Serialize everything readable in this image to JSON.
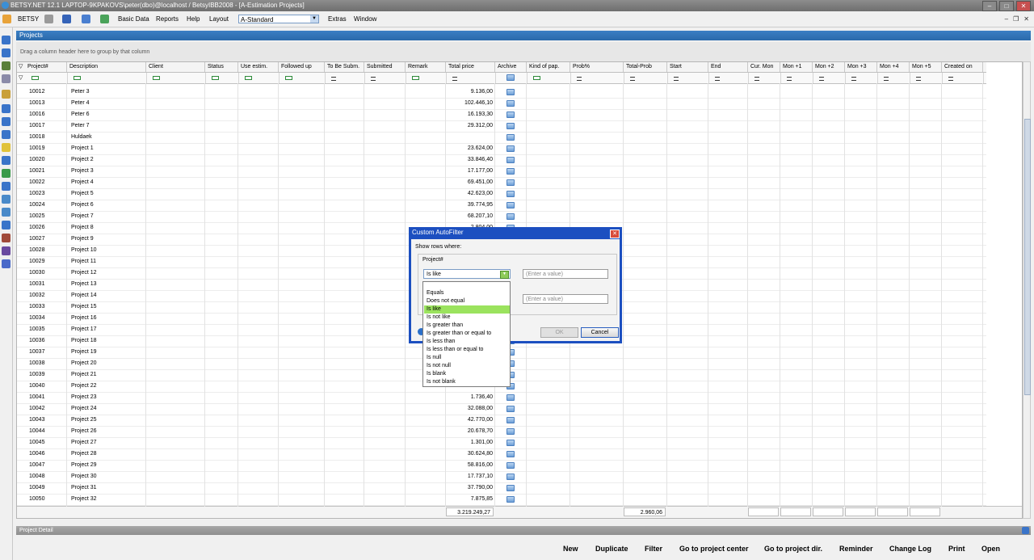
{
  "window": {
    "title": "BETSY.NET 12.1  LAPTOP-9KPAKOVS\\peter(dbo)@localhost / BetsyIBB2008 - [A-Estimation Projects]"
  },
  "menu": {
    "app_label": "BETSY",
    "items": [
      "Basic Data",
      "Reports",
      "Help",
      "Layout"
    ],
    "layout_value": "A-Standard",
    "extras": "Extras",
    "window_label": "Window"
  },
  "panel": {
    "title": "Projects",
    "group_hint": "Drag a column header here to group by that column"
  },
  "columns": [
    "Project#",
    "Description",
    "Client",
    "Status",
    "Use estim.",
    "Followed up",
    "To Be Subm.",
    "Submitted",
    "Remark",
    "Total price",
    "Archive",
    "Kind of pap.",
    "Prob%",
    "Total-Prob",
    "Start",
    "End",
    "Cur. Mon",
    "Mon +1",
    "Mon +2",
    "Mon +3",
    "Mon +4",
    "Mon +5",
    "Created on"
  ],
  "rows": [
    {
      "id": "10012",
      "desc": "Peter 3",
      "price": "9.136,00"
    },
    {
      "id": "10013",
      "desc": "Peter 4",
      "price": "102.446,10"
    },
    {
      "id": "10016",
      "desc": "Peter 6",
      "price": "16.193,30"
    },
    {
      "id": "10017",
      "desc": "Peter 7",
      "price": "29.312,00"
    },
    {
      "id": "10018",
      "desc": "Huldaek",
      "price": ""
    },
    {
      "id": "10019",
      "desc": "Project 1",
      "price": "23.624,00"
    },
    {
      "id": "10020",
      "desc": "Project 2",
      "price": "33.846,40"
    },
    {
      "id": "10021",
      "desc": "Project 3",
      "price": "17.177,00"
    },
    {
      "id": "10022",
      "desc": "Project 4",
      "price": "69.451,00"
    },
    {
      "id": "10023",
      "desc": "Project 5",
      "price": "42.623,00"
    },
    {
      "id": "10024",
      "desc": "Project 6",
      "price": "39.774,95"
    },
    {
      "id": "10025",
      "desc": "Project 7",
      "price": "68.207,10"
    },
    {
      "id": "10026",
      "desc": "Project 8",
      "price": "2.804,00"
    },
    {
      "id": "10027",
      "desc": "Project 9",
      "price": ""
    },
    {
      "id": "10028",
      "desc": "Project 10",
      "price": ""
    },
    {
      "id": "10029",
      "desc": "Project 11",
      "price": ""
    },
    {
      "id": "10030",
      "desc": "Project 12",
      "price": ""
    },
    {
      "id": "10031",
      "desc": "Project 13",
      "price": ""
    },
    {
      "id": "10032",
      "desc": "Project 14",
      "price": ""
    },
    {
      "id": "10033",
      "desc": "Project 15",
      "price": ""
    },
    {
      "id": "10034",
      "desc": "Project 16",
      "price": ""
    },
    {
      "id": "10035",
      "desc": "Project 17",
      "price": ""
    },
    {
      "id": "10036",
      "desc": "Project 18",
      "price": ""
    },
    {
      "id": "10037",
      "desc": "Project 19",
      "price": ""
    },
    {
      "id": "10038",
      "desc": "Project 20",
      "price": ""
    },
    {
      "id": "10039",
      "desc": "Project 21",
      "price": ""
    },
    {
      "id": "10040",
      "desc": "Project 22",
      "price": ""
    },
    {
      "id": "10041",
      "desc": "Project 23",
      "price": "1.736,40"
    },
    {
      "id": "10042",
      "desc": "Project 24",
      "price": "32.088,00"
    },
    {
      "id": "10043",
      "desc": "Project 25",
      "price": "42.770,00"
    },
    {
      "id": "10044",
      "desc": "Project 26",
      "price": "20.678,70"
    },
    {
      "id": "10045",
      "desc": "Project 27",
      "price": "1.301,00"
    },
    {
      "id": "10046",
      "desc": "Project 28",
      "price": "30.624,80"
    },
    {
      "id": "10047",
      "desc": "Project 29",
      "price": "58.816,00"
    },
    {
      "id": "10048",
      "desc": "Project 30",
      "price": "17.737,10"
    },
    {
      "id": "10049",
      "desc": "Project 31",
      "price": "37.790,00"
    },
    {
      "id": "10050",
      "desc": "Project 32",
      "price": "7.875,85"
    }
  ],
  "totals": {
    "total_price": "3.219.249,27",
    "total_prob": "2.960,06"
  },
  "detail": {
    "title": "Project Detail",
    "buttons": [
      "New",
      "Duplicate",
      "Filter",
      "Go to project center",
      "Go to project dir.",
      "Reminder",
      "Change Log",
      "Print",
      "Open"
    ]
  },
  "dialog": {
    "title": "Custom AutoFilter",
    "show_rows": "Show rows where:",
    "field": "Project#",
    "operator": "Is like",
    "value1_placeholder": "(Enter a value)",
    "value2_placeholder": "(Enter a value)",
    "ok": "OK",
    "cancel": "Cancel",
    "options": [
      "Equals",
      "Does not equal",
      "Is like",
      "Is not like",
      "Is greater than",
      "Is greater than or equal to",
      "Is less than",
      "Is less than or equal to",
      "Is null",
      "Is not null",
      "Is blank",
      "Is not blank"
    ],
    "selected_option": "Is like"
  }
}
